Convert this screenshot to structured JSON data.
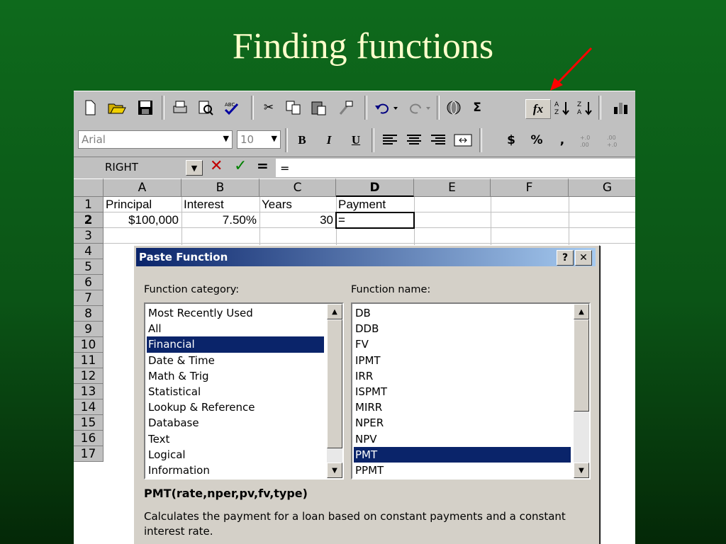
{
  "slide": {
    "title": "Finding functions"
  },
  "toolbar": {
    "sum_glyph": "Σ",
    "paste_function_glyph": "fx",
    "font_name": "Arial",
    "font_size": "10",
    "bold": "B",
    "italic": "I",
    "underline": "U",
    "currency": "$",
    "percent": "%",
    "comma": ","
  },
  "formula_bar": {
    "name_box": "RIGHT",
    "cancel_glyph": "✕",
    "enter_glyph": "✓",
    "equals_glyph": "=",
    "content": "="
  },
  "sheet": {
    "columns": [
      "A",
      "B",
      "C",
      "D",
      "E",
      "F",
      "G"
    ],
    "rows": [
      "1",
      "2",
      "3",
      "4",
      "5",
      "6",
      "7",
      "8",
      "9",
      "10",
      "11",
      "12",
      "13",
      "14",
      "15",
      "16",
      "17"
    ],
    "active_column": "D",
    "active_row": "2",
    "cells": {
      "A1": "Principal",
      "B1": "Interest",
      "C1": "Years",
      "D1": "Payment",
      "A2": "$100,000",
      "B2": "7.50%",
      "C2": "30",
      "D2": "="
    }
  },
  "dialog": {
    "title": "Paste Function",
    "help_label": "?",
    "close_label": "✕",
    "category_label": "Function category:",
    "name_label": "Function name:",
    "categories": [
      "Most Recently Used",
      "All",
      "Financial",
      "Date & Time",
      "Math & Trig",
      "Statistical",
      "Lookup & Reference",
      "Database",
      "Text",
      "Logical",
      "Information"
    ],
    "selected_category": "Financial",
    "functions": [
      "DB",
      "DDB",
      "FV",
      "IPMT",
      "IRR",
      "ISPMT",
      "MIRR",
      "NPER",
      "NPV",
      "PMT",
      "PPMT"
    ],
    "selected_function": "PMT",
    "syntax": "PMT(rate,nper,pv,fv,type)",
    "description": "Calculates the payment for a loan based on constant payments and a constant interest rate."
  },
  "colors": {
    "background": "#0b5416",
    "title_text": "#ffffcc",
    "arrow": "#ff0000",
    "selection": "#0a246a"
  }
}
